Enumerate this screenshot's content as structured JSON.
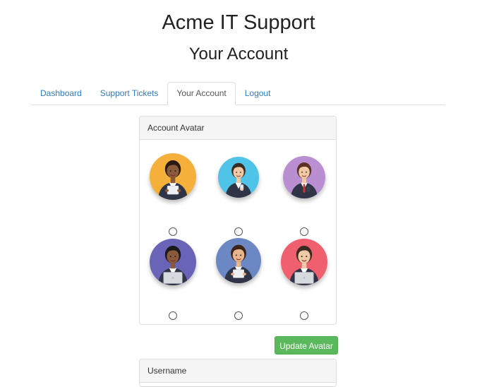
{
  "header": {
    "site_title": "Acme IT Support",
    "page_title": "Your Account"
  },
  "tabs": [
    {
      "label": "Dashboard",
      "active": false
    },
    {
      "label": "Support Tickets",
      "active": false
    },
    {
      "label": "Your Account",
      "active": true
    },
    {
      "label": "Logout",
      "active": false
    }
  ],
  "avatar_panel": {
    "heading": "Account Avatar",
    "avatars": [
      {
        "name": "avatar-1",
        "bg": "#f4b03a",
        "skin": "#8b5a3c",
        "hair": "#2a1a12",
        "suit": "#2f3447",
        "prop": "tablet",
        "selected": false
      },
      {
        "name": "avatar-2",
        "bg": "#4fc3e8",
        "skin": "#f1c9a5",
        "hair": "#3b2a20",
        "suit": "#2f3447",
        "prop": "phone",
        "selected": false
      },
      {
        "name": "avatar-3",
        "bg": "#b98fd1",
        "skin": "#f1c9a5",
        "hair": "#5a3222",
        "suit": "#2f3447",
        "prop": "tie",
        "selected": false
      },
      {
        "name": "avatar-4",
        "bg": "#6a64b8",
        "skin": "#8b5a3c",
        "hair": "#1a1a1a",
        "suit": "#2f3447",
        "prop": "laptop",
        "selected": false
      },
      {
        "name": "avatar-5",
        "bg": "#6c88c4",
        "skin": "#e7b48c",
        "hair": "#3a2416",
        "suit": "#2f3447",
        "prop": "tablet",
        "selected": false
      },
      {
        "name": "avatar-6",
        "bg": "#ef5f6e",
        "skin": "#f1c9a5",
        "hair": "#3b2a20",
        "suit": "#2f3447",
        "prop": "laptop",
        "selected": false
      }
    ]
  },
  "update_button": {
    "label": "Update Avatar"
  },
  "username_panel": {
    "heading": "Username"
  },
  "colors": {
    "link": "#337ab7",
    "success": "#5cb85c"
  }
}
